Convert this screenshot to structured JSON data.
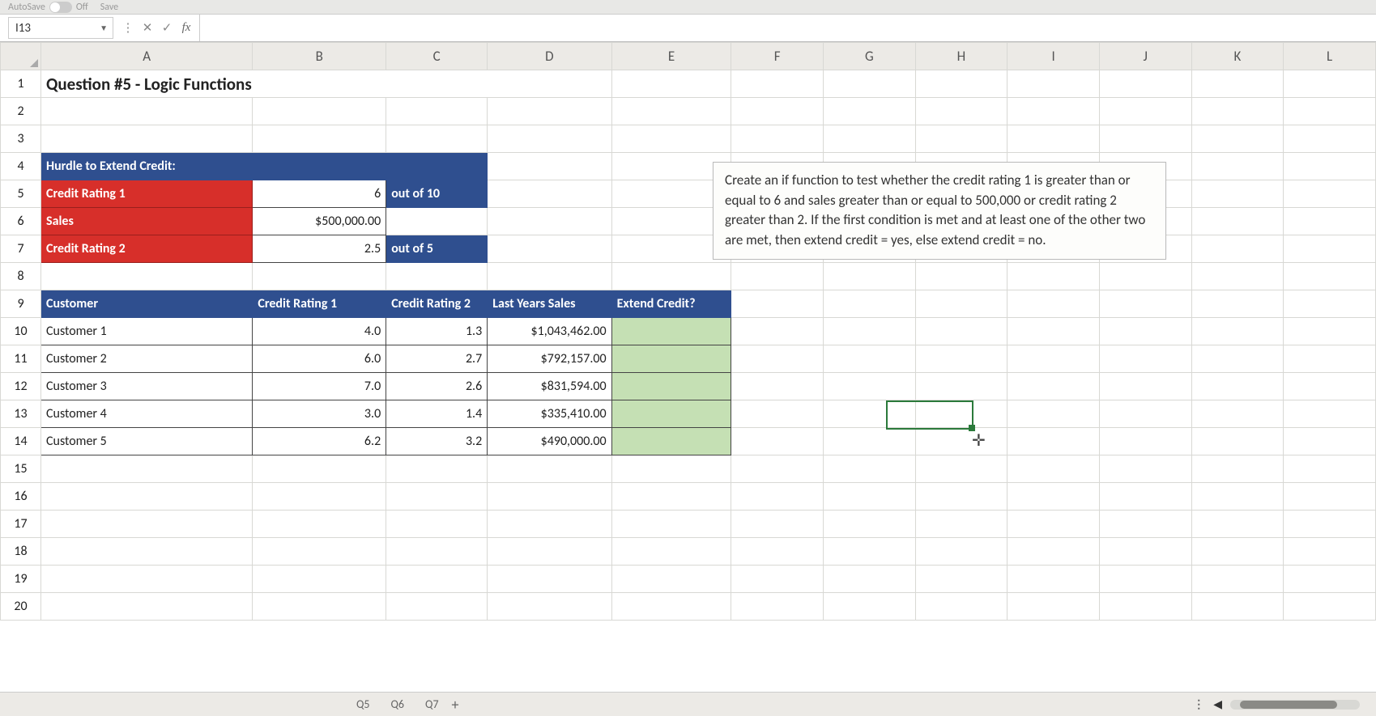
{
  "toolbar": {
    "autosave_label": "AutoSave",
    "autosave_state": "Off",
    "save_label": "Save"
  },
  "formula_bar": {
    "name_box": "I13",
    "cancel": "✕",
    "accept": "✓",
    "fx": "fx",
    "formula": ""
  },
  "columns": [
    "A",
    "B",
    "C",
    "D",
    "E",
    "F",
    "G",
    "H",
    "I",
    "J",
    "K",
    "L"
  ],
  "rows": [
    "1",
    "2",
    "3",
    "4",
    "5",
    "6",
    "7",
    "8",
    "9",
    "10",
    "11",
    "12",
    "13",
    "14",
    "15",
    "16",
    "17",
    "18",
    "19",
    "20"
  ],
  "cells": {
    "A1": "Question #5 - Logic Functions",
    "A4": "Hurdle to Extend Credit:",
    "A5": "Credit Rating 1",
    "B5": "6",
    "C5": "out of 10",
    "A6": "Sales",
    "B6": "$500,000.00",
    "A7": "Credit Rating 2",
    "B7": "2.5",
    "C7": "out of 5",
    "A9": "Customer",
    "B9": "Credit Rating 1",
    "C9": "Credit Rating 2",
    "D9": "Last Years Sales",
    "E9": "Extend Credit?",
    "A10": "Customer 1",
    "B10": "4.0",
    "C10": "1.3",
    "D10": "$1,043,462.00",
    "A11": "Customer 2",
    "B11": "6.0",
    "C11": "2.7",
    "D11": "$792,157.00",
    "A12": "Customer 3",
    "B12": "7.0",
    "C12": "2.6",
    "D12": "$831,594.00",
    "A13": "Customer 4",
    "B13": "3.0",
    "C13": "1.4",
    "D13": "$335,410.00",
    "A14": "Customer 5",
    "B14": "6.2",
    "C14": "3.2",
    "D14": "$490,000.00"
  },
  "instruction_text": "Create an if function to test whether the credit rating 1 is greater than or equal to 6 and sales greater than or equal to 500,000 or credit rating 2 greater than 2.  If the first condition is met and at least one of the other two are met, then extend credit = yes, else extend credit = no.",
  "bottom": {
    "tab1": "Q5",
    "tab2": "Q6",
    "tab3": "Q7",
    "plus": "+"
  }
}
